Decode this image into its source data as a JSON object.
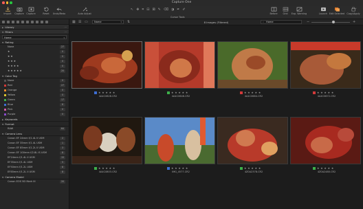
{
  "window": {
    "title": "Capture One",
    "traffic_lights": [
      "#ff5f57",
      "#febc2e",
      "#28c840"
    ]
  },
  "toolbar": {
    "left": [
      {
        "label": "Import",
        "icon": "import-icon"
      },
      {
        "label": "Capture",
        "icon": "camera-icon"
      },
      {
        "label": "Capture",
        "icon": "capture-icon"
      },
      {
        "label": "Reset",
        "icon": "reset-icon"
      },
      {
        "label": "Undo/Redo",
        "icon": "undo-redo-icon"
      },
      {
        "label": "Auto Adjust",
        "icon": "auto-adjust-icon"
      }
    ],
    "cursor_tools_label": "Cursor Tools",
    "right": [
      {
        "label": "Before",
        "icon": "before-after-icon"
      },
      {
        "label": "Grid",
        "icon": "grid-icon"
      },
      {
        "label": "Exp. Warning",
        "icon": "exposure-warning-icon"
      },
      {
        "label": "Launch",
        "icon": "launch-icon"
      },
      {
        "label": "Edit Selected",
        "icon": "edit-selected-icon"
      },
      {
        "label": "Copy/Apply",
        "icon": "copy-apply-icon"
      }
    ]
  },
  "sidebar": {
    "library_label": "Library",
    "filters_label": "Filters",
    "filters_select": "Home",
    "rating": {
      "label": "Rating",
      "rows": [
        {
          "label": "None",
          "count": "27"
        },
        {
          "label": "★",
          "count": "0"
        },
        {
          "label": "★ ★",
          "count": "0"
        },
        {
          "label": "★ ★ ★",
          "count": "0"
        },
        {
          "label": "★ ★ ★ ★",
          "count": "0"
        },
        {
          "label": "★ ★ ★ ★ ★",
          "count": "20"
        }
      ]
    },
    "color_tag": {
      "label": "Color Tag",
      "rows": [
        {
          "label": "None",
          "color": "#555555",
          "count": "0"
        },
        {
          "label": "Red",
          "color": "#d33a3a",
          "count": "27"
        },
        {
          "label": "Orange",
          "color": "#e08a2c",
          "count": "0"
        },
        {
          "label": "Yellow",
          "color": "#d9c22e",
          "count": "0"
        },
        {
          "label": "Green",
          "color": "#3db04a",
          "count": "17"
        },
        {
          "label": "Blue",
          "color": "#3d6ed3",
          "count": "8"
        },
        {
          "label": "Pink",
          "color": "#d35aa8",
          "count": "0"
        },
        {
          "label": "Purple",
          "color": "#8a4ac9",
          "count": "0"
        }
      ]
    },
    "keywords_label": "Keywords",
    "format": {
      "label": "Format",
      "rows": [
        {
          "label": "RAW",
          "count": "64"
        }
      ]
    },
    "camera_lens": {
      "label": "Camera Lens",
      "rows": [
        {
          "label": "Canon EF 24mm f/1.4L II USM",
          "count": "2"
        },
        {
          "label": "Canon EF 35mm f/1.4L USM",
          "count": "1"
        },
        {
          "label": "Canon EF 85mm f/1.2L II USM",
          "count": "3"
        },
        {
          "label": "Canon EF 100mm f/2.8L IS USM",
          "count": "8"
        },
        {
          "label": "EF24mm f/1.4L II USM",
          "count": "15"
        },
        {
          "label": "EF35mm f/1.4L USM",
          "count": "5"
        },
        {
          "label": "EF50mm f/1.2L USM",
          "count": "8"
        },
        {
          "label": "EF85mm f/1.2L II USM",
          "count": "8"
        }
      ]
    },
    "camera_model": {
      "label": "Camera Model",
      "rows": [
        {
          "label": "Canon EOS 5D Mark III",
          "count": "20"
        }
      ]
    }
  },
  "browser": {
    "sort_value": "Name",
    "count_text": "8 Images (Filtered)",
    "search_value": "Home",
    "images": [
      {
        "filename": "4A4C0628.CR2",
        "label_color": "#3d6ed3",
        "stars": "★ ★ ★ ★ ★"
      },
      {
        "filename": "4A4C0646.CR2",
        "label_color": "#3db04a",
        "stars": "★ ★ ★ ★ ★"
      },
      {
        "filename": "4A4C0684.CR2",
        "label_color": "#d33a3a",
        "stars": "★ ★ ★ ★ ★"
      },
      {
        "filename": "4A4C0672.CR2",
        "label_color": "#d33a3a",
        "stars": "★ ★ ★ ★ ★"
      },
      {
        "filename": "4A4C0803.CR2",
        "label_color": "#3db04a",
        "stars": "★ ★ ★ ★ ★"
      },
      {
        "filename": "IMG_4577.CR2",
        "label_color": "#3d6ed3",
        "stars": "★ ★ ★ ★ ★"
      },
      {
        "filename": "4Z0A2378.CR2",
        "label_color": "#3db04a",
        "stars": "★ ★ ★ ★ ★"
      },
      {
        "filename": "4Z0A2480.CR2",
        "label_color": "#3db04a",
        "stars": "★ ★ ★ ★ ★"
      }
    ]
  }
}
